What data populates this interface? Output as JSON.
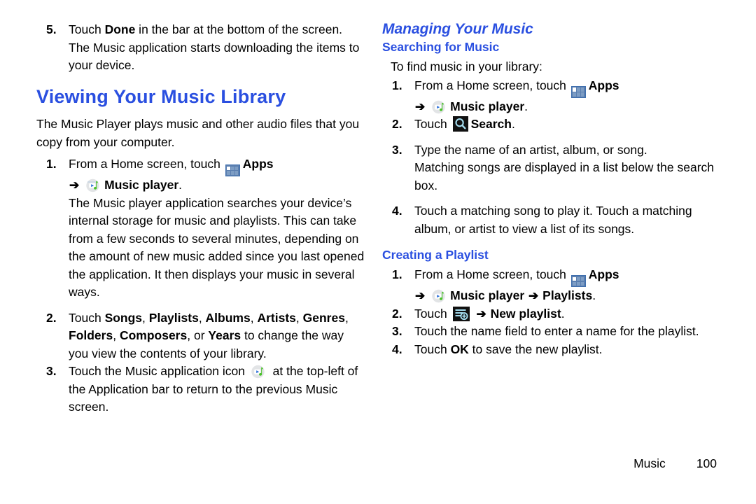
{
  "document": {
    "footer": {
      "section": "Music",
      "page_number": "100"
    }
  },
  "colors": {
    "heading_blue": "#2a4fe0",
    "body_black": "#000000",
    "icon_cyan": "#9fd8e8",
    "icon_blue": "#2c6fd8",
    "icon_green": "#49c12a"
  },
  "left_column": {
    "step5": {
      "number": "5.",
      "text_before_bold": "Touch ",
      "bold": "Done",
      "text_after_bold": " in the bar at the bottom of the screen.",
      "continuation": "The Music application starts downloading the items to your device."
    },
    "heading": "Viewing Your Music Library",
    "intro": "The Music Player plays music and other audio files that you copy from your computer.",
    "steps": [
      {
        "number": "1.",
        "text": "From a Home screen, touch ",
        "apps_label": "Apps",
        "icon_apps": "apps-grid-icon",
        "sub_arrow": "➔",
        "icon_music": "music-player-icon",
        "music_label": "Music player",
        "sub_trailing": ".",
        "continuation": "The Music player application searches your device’s internal storage for music and playlists. This can take from a few seconds to several minutes, depending on the amount of new music added since you last opened the application. It then displays your music in several ways."
      },
      {
        "number": "2.",
        "prefix": "Touch ",
        "options": [
          "Songs",
          "Playlists",
          "Albums",
          "Artists",
          "Genres",
          "Folders",
          "Composers"
        ],
        "mid": ", or ",
        "last_option": "Years",
        "suffix": " to change the way you view the contents of your library."
      },
      {
        "number": "3.",
        "prefix": "Touch the Music application icon ",
        "icon_music": "music-player-icon",
        "suffix": " at the top-left of the Application bar to return to the previous Music screen."
      }
    ]
  },
  "right_column": {
    "heading_main": "Managing Your Music",
    "heading_sub_1": "Searching for Music",
    "lead_1": "To find music in your library:",
    "search_steps": [
      {
        "number": "1.",
        "text": "From a Home screen, touch ",
        "apps_label": "Apps",
        "icon_apps": "apps-grid-icon",
        "sub_arrow": "➔",
        "icon_music": "music-player-icon",
        "music_label": "Music player",
        "sub_trailing": "."
      },
      {
        "number": "2.",
        "prefix": "Touch ",
        "icon_search": "search-icon",
        "label": "Search",
        "suffix": "."
      },
      {
        "number": "3.",
        "text": "Type the name of an artist, album, or song.",
        "continuation": "Matching songs are displayed in a list below the search box."
      },
      {
        "number": "4.",
        "text": "Touch a matching song to play it. Touch a matching album, or artist to view a list of its songs."
      }
    ],
    "heading_sub_2": "Creating a Playlist",
    "playlist_steps": [
      {
        "number": "1.",
        "text": "From a Home screen, touch ",
        "apps_label": "Apps",
        "icon_apps": "apps-grid-icon",
        "sub_arrow": "➔",
        "icon_music": "music-player-icon",
        "music_label": "Music player",
        "sub_arrow2": "➔",
        "playlists_label": "Playlists",
        "sub_trailing": "."
      },
      {
        "number": "2.",
        "prefix": "Touch ",
        "icon_newplaylist": "new-playlist-icon",
        "arrow": "➔",
        "label": "New playlist",
        "suffix": "."
      },
      {
        "number": "3.",
        "text": "Touch the name field to enter a name for the playlist."
      },
      {
        "number": "4.",
        "prefix": "Touch ",
        "bold": "OK",
        "suffix": " to save the new playlist."
      }
    ]
  }
}
